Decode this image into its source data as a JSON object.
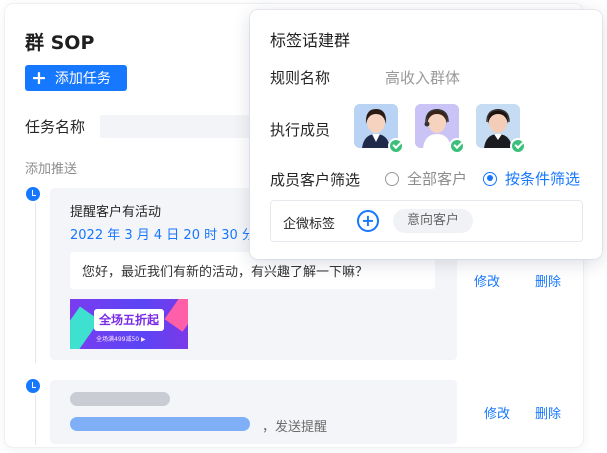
{
  "page": {
    "title": "群 SOP",
    "add_button": "添加任务",
    "task_name_label": "任务名称",
    "add_push_label": "添加推送"
  },
  "timeline": [
    {
      "title": "提醒客户有活动",
      "time": "2022 年 3 月 4 日 20 时 30 分",
      "message": "您好，最近我们有新的活动，有兴趣了解一下嘛？",
      "banner_text": "全场五折起",
      "banner_sub": "全场满499减50 ▶",
      "actions": {
        "edit": "修改",
        "delete": "删除"
      }
    },
    {
      "send_text": "，发送提醒",
      "actions": {
        "edit": "修改",
        "delete": "删除"
      }
    }
  ],
  "popup": {
    "title": "标签话建群",
    "rule_name_label": "规则名称",
    "rule_name_value": "高收入群体",
    "members_label": "执行成员",
    "members": [
      {
        "icon": "avatar-agent-1",
        "selected": true
      },
      {
        "icon": "avatar-agent-2",
        "selected": true
      },
      {
        "icon": "avatar-agent-3",
        "selected": true
      }
    ],
    "filter_label": "成员客户筛选",
    "filter_options": [
      {
        "label": "全部客户",
        "checked": false
      },
      {
        "label": "按条件筛选",
        "checked": true
      }
    ],
    "tag_label": "企微标签",
    "tag_chip": "意向客户"
  },
  "colors": {
    "primary": "#1677ff",
    "success": "#3cbf7a",
    "muted": "#8c8c8c"
  }
}
